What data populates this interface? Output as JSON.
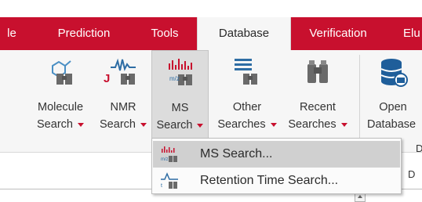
{
  "tabs": [
    {
      "label": "le"
    },
    {
      "label": "Prediction"
    },
    {
      "label": "Tools"
    },
    {
      "label": "Database"
    },
    {
      "label": "Verification"
    },
    {
      "label": "Elu"
    }
  ],
  "ribbon": {
    "molecule_search": {
      "line1": "Molecule",
      "line2": "Search"
    },
    "nmr_search": {
      "line1": "NMR",
      "line2": "Search"
    },
    "ms_search": {
      "line1": "MS",
      "line2": "Search"
    },
    "other_searches": {
      "line1": "Other",
      "line2": "Searches"
    },
    "recent_searches": {
      "line1": "Recent",
      "line2": "Searches"
    },
    "open_database": {
      "line1": "Open",
      "line2": "Database"
    },
    "group_label": "D",
    "nmr_badge": "J"
  },
  "menu": {
    "items": [
      {
        "label": "MS Search...",
        "icon": "ms-spectrum-icon"
      },
      {
        "label": "Retention Time Search...",
        "icon": "retention-time-icon"
      }
    ]
  },
  "lower": {
    "right_stub": "D"
  },
  "colors": {
    "accent": "#c8102e",
    "ribbon_bg": "#f6f6f6",
    "menu_highlight": "#d0d0d0"
  }
}
